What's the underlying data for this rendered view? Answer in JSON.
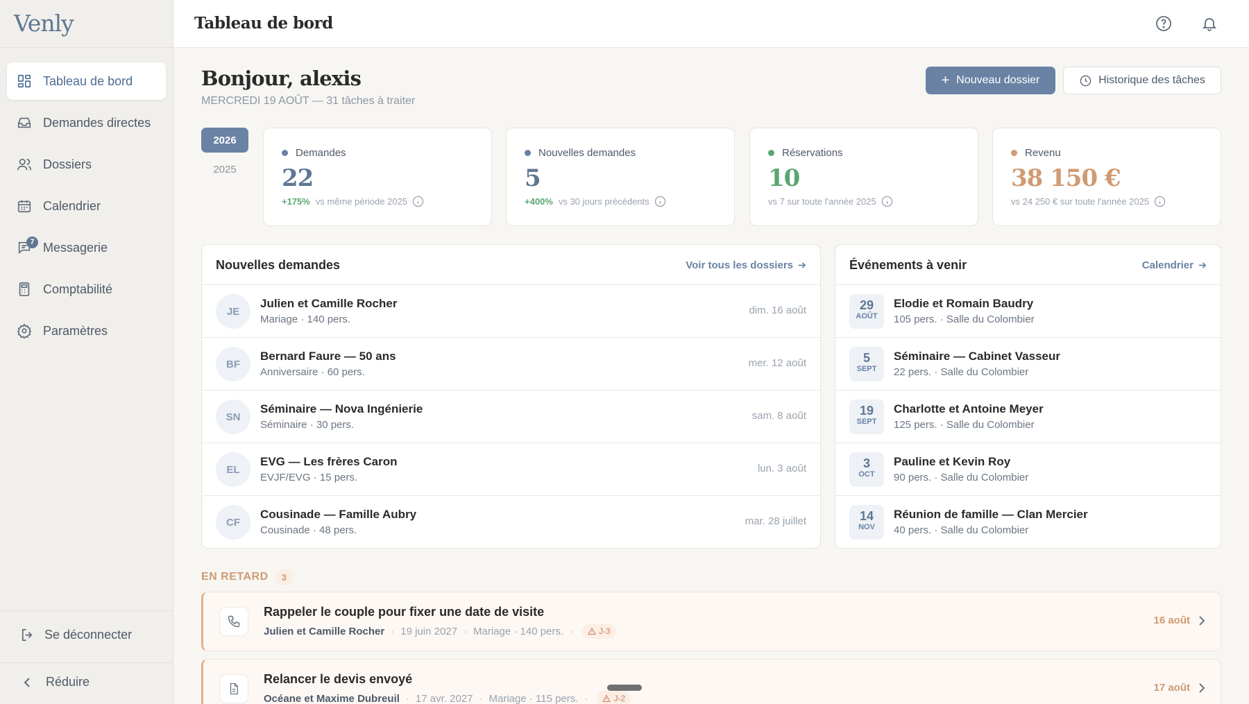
{
  "app": {
    "logo": "Venly"
  },
  "sidebar": {
    "items": [
      {
        "label": "Tableau de bord",
        "icon": "dashboard-icon",
        "active": true
      },
      {
        "label": "Demandes directes",
        "icon": "inbox-icon"
      },
      {
        "label": "Dossiers",
        "icon": "users-icon"
      },
      {
        "label": "Calendrier",
        "icon": "calendar-icon"
      },
      {
        "label": "Messagerie",
        "icon": "message-icon",
        "badge": "7"
      },
      {
        "label": "Comptabilité",
        "icon": "calculator-icon"
      },
      {
        "label": "Paramètres",
        "icon": "gear-icon"
      }
    ],
    "logout": "Se déconnecter",
    "collapse": "Réduire"
  },
  "topbar": {
    "title": "Tableau de bord"
  },
  "header": {
    "greeting": "Bonjour, alexis",
    "subtitle": "MERCREDI 19 AOÛT — 31 tâches à traiter",
    "new_button": "Nouveau dossier",
    "history_button": "Historique des tâches"
  },
  "years": {
    "active": "2026",
    "other": "2025"
  },
  "stats": [
    {
      "label": "Demandes",
      "value": "22",
      "pct": "+175%",
      "note": "vs même période 2025",
      "color": "#6a82a4"
    },
    {
      "label": "Nouvelles demandes",
      "value": "5",
      "pct": "+400%",
      "note": "vs 30 jours précédents",
      "color": "#6a82a4"
    },
    {
      "label": "Réservations",
      "value": "10",
      "pct": "",
      "note": "vs 7 sur toute l'année 2025",
      "color": "#5aa671"
    },
    {
      "label": "Revenu",
      "value": "38 150 €",
      "pct": "",
      "note": "vs 24 250 € sur toute l'année 2025",
      "color": "#d09a72"
    }
  ],
  "requests": {
    "title": "Nouvelles demandes",
    "link": "Voir tous les dossiers",
    "rows": [
      {
        "initials": "JE",
        "name": "Julien et Camille Rocher",
        "detail": "Mariage · 140 pers.",
        "date": "dim. 16 août"
      },
      {
        "initials": "BF",
        "name": "Bernard Faure — 50 ans",
        "detail": "Anniversaire · 60 pers.",
        "date": "mer. 12 août"
      },
      {
        "initials": "SN",
        "name": "Séminaire — Nova Ingénierie",
        "detail": "Séminaire · 30 pers.",
        "date": "sam. 8 août"
      },
      {
        "initials": "EL",
        "name": "EVG — Les frères Caron",
        "detail": "EVJF/EVG · 15 pers.",
        "date": "lun. 3 août"
      },
      {
        "initials": "CF",
        "name": "Cousinade — Famille Aubry",
        "detail": "Cousinade · 48 pers.",
        "date": "mar. 28 juillet"
      }
    ]
  },
  "events": {
    "title": "Événements à venir",
    "link": "Calendrier",
    "rows": [
      {
        "day": "29",
        "month": "AOÛT",
        "name": "Elodie et Romain Baudry",
        "detail": "105 pers. · Salle du Colombier"
      },
      {
        "day": "5",
        "month": "SEPT",
        "name": "Séminaire — Cabinet Vasseur",
        "detail": "22 pers. · Salle du Colombier"
      },
      {
        "day": "19",
        "month": "SEPT",
        "name": "Charlotte et Antoine Meyer",
        "detail": "125 pers. · Salle du Colombier"
      },
      {
        "day": "3",
        "month": "OCT",
        "name": "Pauline et Kevin Roy",
        "detail": "90 pers. · Salle du Colombier"
      },
      {
        "day": "14",
        "month": "NOV",
        "name": "Réunion de famille — Clan Mercier",
        "detail": "40 pers. · Salle du Colombier"
      }
    ]
  },
  "overdue": {
    "label": "EN RETARD",
    "count": "3",
    "tasks": [
      {
        "title": "Rappeler le couple pour fixer une date de visite",
        "who": "Julien et Camille Rocher",
        "event_date": "19 juin 2027",
        "detail": "Mariage · 140 pers.",
        "tag": "J-3",
        "due": "16 août",
        "icon": "phone-icon"
      },
      {
        "title": "Relancer le devis envoyé",
        "who": "Océane et Maxime Dubreuil",
        "event_date": "17 avr. 2027",
        "detail": "Mariage · 115 pers.",
        "tag": "J-2",
        "due": "17 août",
        "icon": "document-icon"
      }
    ]
  }
}
